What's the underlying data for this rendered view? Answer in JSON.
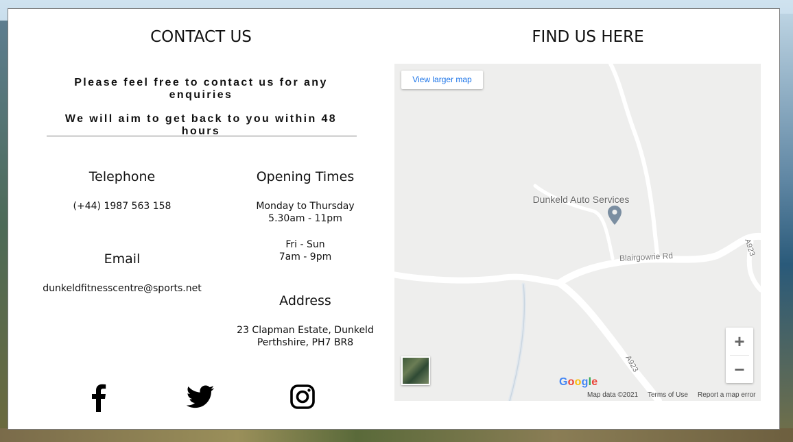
{
  "contact": {
    "title": "CONTACT US",
    "line1": "Please feel free to contact us for any enquiries",
    "line2": "We will aim to get back to you within 48 hours"
  },
  "telephone": {
    "heading": "Telephone",
    "value": "(+44) 1987 563 158"
  },
  "email": {
    "heading": "Email",
    "value": "dunkeldfitnesscentre@sports.net"
  },
  "opening": {
    "heading": "Opening Times",
    "weekday_days": "Monday to Thursday",
    "weekday_hours": "5.30am - 11pm",
    "weekend_days": "Fri - Sun",
    "weekend_hours": "7am - 9pm"
  },
  "address": {
    "heading": "Address",
    "line1": "23 Clapman Estate, Dunkeld",
    "line2": "Perthshire, PH7 BR8"
  },
  "social": {
    "icons": [
      "facebook-icon",
      "twitter-icon",
      "instagram-icon"
    ]
  },
  "find": {
    "title": "FIND US HERE"
  },
  "map": {
    "view_larger": "View larger map",
    "place": "Dunkeld Auto Services",
    "road_blairgowrie": "Blairgowrie Rd",
    "road_a923": "A923",
    "zoom_in": "+",
    "zoom_out": "−",
    "logo": "Google",
    "map_data": "Map data ©2021",
    "terms": "Terms of Use",
    "report": "Report a map error"
  },
  "colors": {
    "card_bg": "#ffffff",
    "text": "#111111",
    "map_bg": "#eeeeed",
    "map_link": "#1a73e8"
  }
}
